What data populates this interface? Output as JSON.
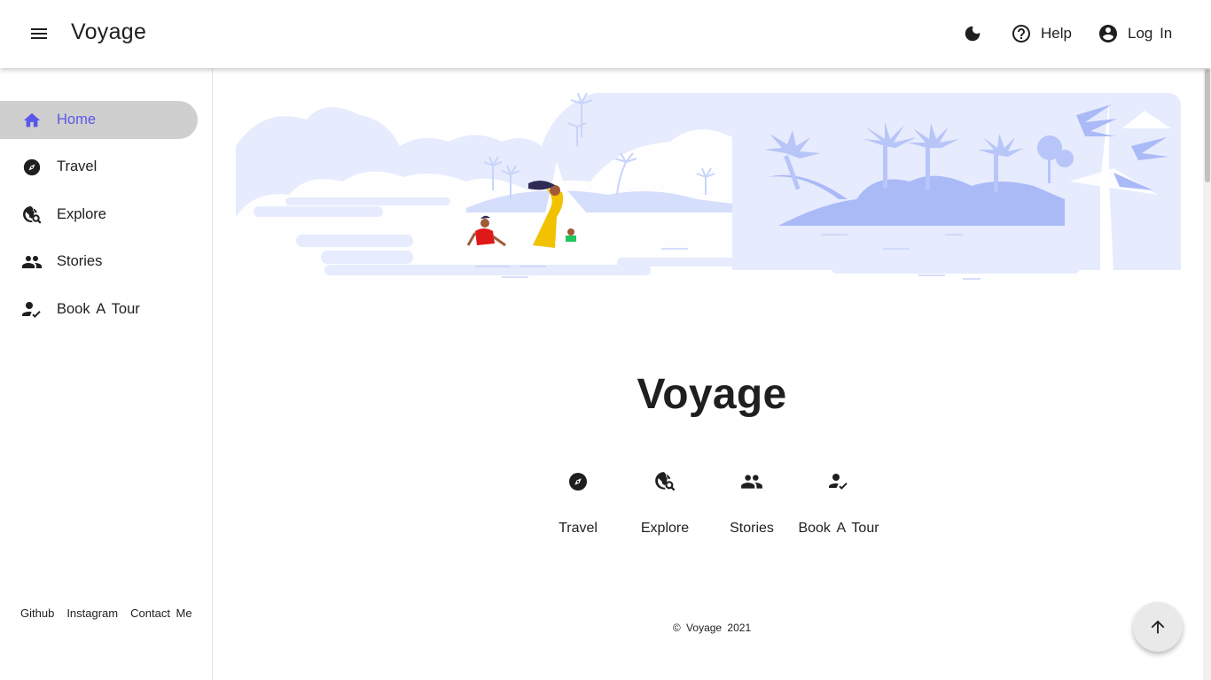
{
  "appbar": {
    "title": "Voyage",
    "menu_icon": "menu-icon",
    "theme_icon": "moon-icon",
    "help_label": "Help",
    "help_icon": "help-circle-icon",
    "login_label": "Log In",
    "login_icon": "account-circle-icon"
  },
  "sidebar": {
    "items": [
      {
        "label": "Home",
        "icon": "home-icon",
        "active": true
      },
      {
        "label": "Travel",
        "icon": "compass-icon",
        "active": false
      },
      {
        "label": "Explore",
        "icon": "travel-explore-icon",
        "active": false
      },
      {
        "label": "Stories",
        "icon": "people-icon",
        "active": false
      },
      {
        "label": "Book A Tour",
        "icon": "how-to-reg-icon",
        "active": false
      }
    ],
    "footer_links": [
      "Github",
      "Instagram",
      "Contact Me"
    ]
  },
  "main": {
    "title": "Voyage",
    "quick_links": [
      {
        "label": "Travel",
        "icon": "compass-icon"
      },
      {
        "label": "Explore",
        "icon": "travel-explore-icon"
      },
      {
        "label": "Stories",
        "icon": "people-icon"
      },
      {
        "label": "Book A Tour",
        "icon": "how-to-reg-icon"
      }
    ],
    "copyright": "© Voyage 2021"
  },
  "colors": {
    "accent": "#5b57e8",
    "active_bg": "#cfcfcf",
    "hero_light": "#e6ebfd",
    "hero_mid": "#aabaf7"
  }
}
